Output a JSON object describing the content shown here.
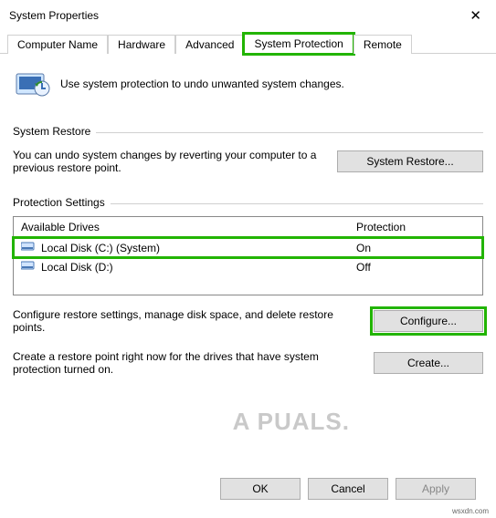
{
  "window": {
    "title": "System Properties"
  },
  "tabs": {
    "computer_name": "Computer Name",
    "hardware": "Hardware",
    "advanced": "Advanced",
    "system_protection": "System Protection",
    "remote": "Remote"
  },
  "intro": "Use system protection to undo unwanted system changes.",
  "system_restore": {
    "heading": "System Restore",
    "text": "You can undo system changes by reverting your computer to a previous restore point.",
    "button": "System Restore..."
  },
  "protection_settings": {
    "heading": "Protection Settings",
    "col_drives": "Available Drives",
    "col_protection": "Protection",
    "rows": [
      {
        "name": "Local Disk (C:) (System)",
        "protection": "On"
      },
      {
        "name": "Local Disk (D:)",
        "protection": "Off"
      }
    ],
    "configure_text": "Configure restore settings, manage disk space, and delete restore points.",
    "configure_button": "Configure...",
    "create_text": "Create a restore point right now for the drives that have system protection turned on.",
    "create_button": "Create..."
  },
  "footer": {
    "ok": "OK",
    "cancel": "Cancel",
    "apply": "Apply"
  },
  "watermark": "A   PUALS.",
  "wsx": "wsxdn.com"
}
